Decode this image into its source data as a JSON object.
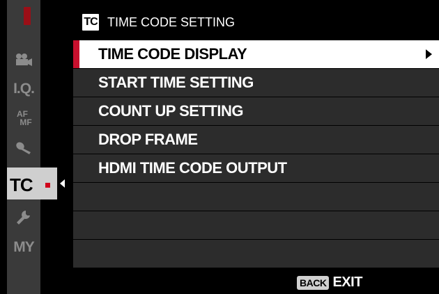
{
  "header": {
    "badge": "TC",
    "title": "TIME CODE SETTING"
  },
  "sidebar": {
    "items": [
      {
        "icon": "movie-camera-icon"
      },
      {
        "label": "I.Q."
      },
      {
        "label_top": "AF",
        "label_bottom": "MF"
      },
      {
        "icon": "microphone-icon"
      },
      {
        "label": "TC",
        "active": true
      },
      {
        "icon": "wrench-icon"
      },
      {
        "label": "MY"
      }
    ]
  },
  "menu": {
    "items": [
      {
        "label": "TIME CODE DISPLAY",
        "selected": true
      },
      {
        "label": "START TIME SETTING"
      },
      {
        "label": "COUNT UP SETTING"
      },
      {
        "label": "DROP FRAME"
      },
      {
        "label": "HDMI TIME CODE OUTPUT"
      },
      {
        "label": ""
      },
      {
        "label": ""
      },
      {
        "label": ""
      }
    ]
  },
  "footer": {
    "back": "BACK",
    "exit": "EXIT"
  },
  "colors": {
    "accent_red": "#c8102e",
    "row_bg": "#2c2c2c",
    "selected_bg": "#ffffff"
  }
}
